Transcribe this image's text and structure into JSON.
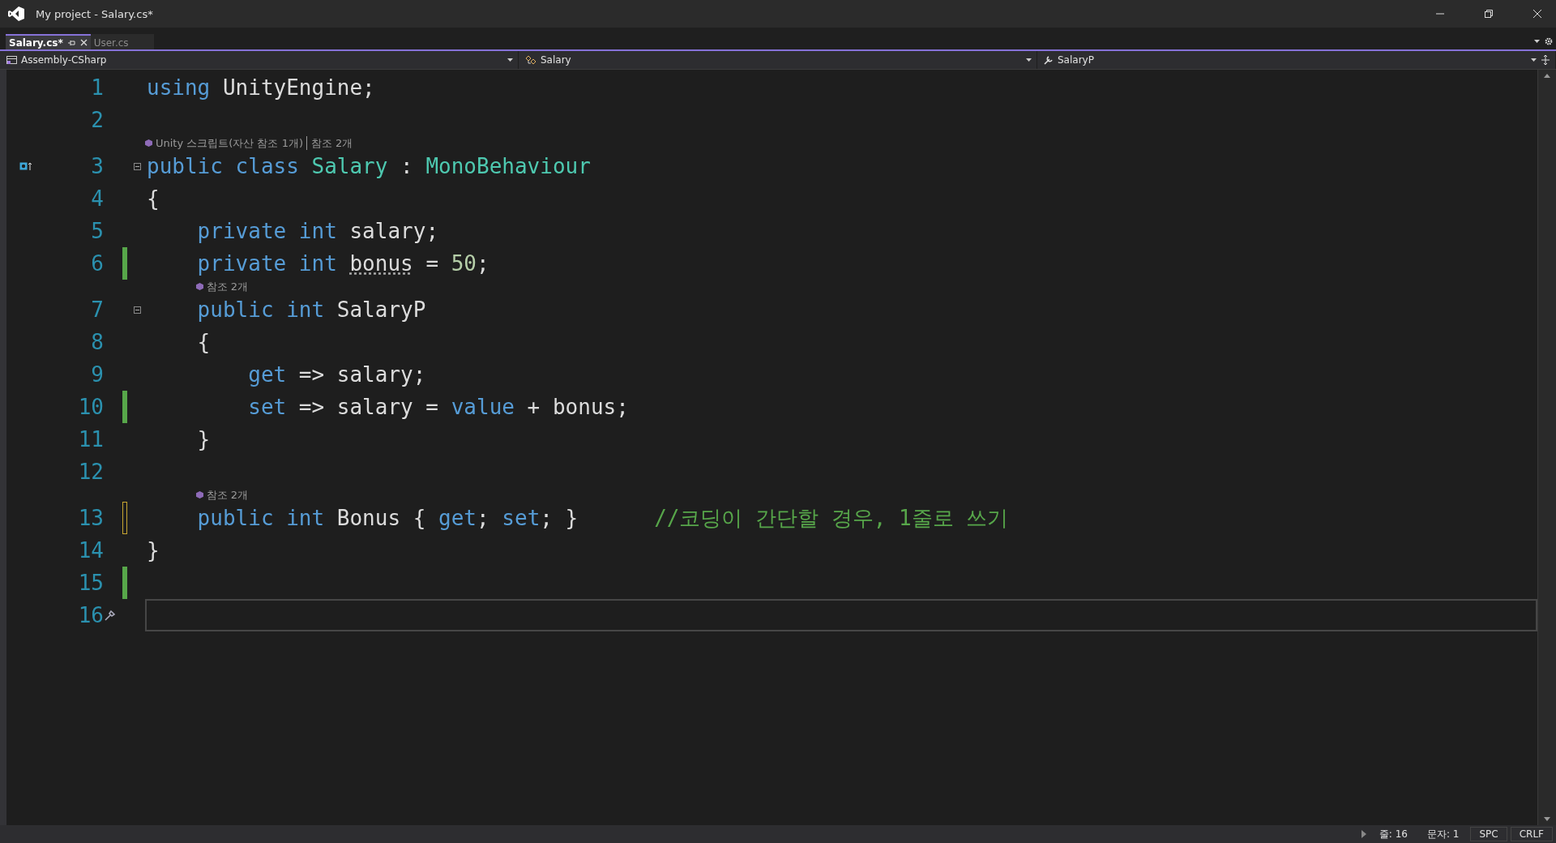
{
  "window": {
    "title": "My project - Salary.cs*"
  },
  "tabs": [
    {
      "label": "Salary.cs*",
      "selected": true
    },
    {
      "label": "User.cs",
      "selected": false
    }
  ],
  "nav": {
    "project": "Assembly-CSharp",
    "type": "Salary",
    "member": "SalaryP"
  },
  "lines": [
    {
      "number": "1",
      "changed": false,
      "tokens": [
        {
          "text": "using",
          "kind": "keyword"
        },
        {
          "text": " UnityEngine;",
          "kind": "plain"
        }
      ]
    },
    {
      "number": "2",
      "changed": false
    },
    {
      "number": "3",
      "changed": false,
      "fold": true,
      "glyph": true,
      "codelens": [
        "Unity 스크립트(자산 참조 1개)",
        "참조 2개"
      ],
      "tokens": [
        {
          "text": "public class ",
          "kind": "keyword"
        },
        {
          "text": "Salary",
          "kind": "type"
        },
        {
          "text": " : ",
          "kind": "plain"
        },
        {
          "text": "MonoBehaviour",
          "kind": "type"
        }
      ]
    },
    {
      "number": "4",
      "changed": false,
      "tokens": [
        {
          "text": "{",
          "kind": "plain"
        }
      ]
    },
    {
      "number": "5",
      "changed": false,
      "tokens": [
        {
          "text": "    private int",
          "kind": "keyword"
        },
        {
          "text": " salary;",
          "kind": "plain"
        }
      ]
    },
    {
      "number": "6",
      "changed": true,
      "saved": true,
      "tokens": [
        {
          "text": "    private int ",
          "kind": "keyword"
        },
        {
          "text": "bonus",
          "kind": "plain",
          "hint": true
        },
        {
          "text": " = ",
          "kind": "plain"
        },
        {
          "text": "50",
          "kind": "number"
        },
        {
          "text": ";",
          "kind": "plain"
        }
      ]
    },
    {
      "number": "7",
      "changed": false,
      "fold": true,
      "codelens": [
        "참조 2개"
      ],
      "tokens": [
        {
          "text": "    public int",
          "kind": "keyword"
        },
        {
          "text": " SalaryP",
          "kind": "plain"
        }
      ]
    },
    {
      "number": "8",
      "changed": false,
      "tokens": [
        {
          "text": "    {",
          "kind": "plain"
        }
      ]
    },
    {
      "number": "9",
      "changed": false,
      "tokens": [
        {
          "text": "        get",
          "kind": "keyword"
        },
        {
          "text": " => salary;",
          "kind": "plain"
        }
      ]
    },
    {
      "number": "10",
      "changed": true,
      "saved": true,
      "tokens": [
        {
          "text": "        set",
          "kind": "keyword"
        },
        {
          "text": " => salary = ",
          "kind": "plain"
        },
        {
          "text": "value",
          "kind": "keyword"
        },
        {
          "text": " + bonus;",
          "kind": "plain"
        }
      ]
    },
    {
      "number": "11",
      "changed": false,
      "tokens": [
        {
          "text": "    }",
          "kind": "plain"
        }
      ]
    },
    {
      "number": "12",
      "changed": false
    },
    {
      "number": "13",
      "changed": true,
      "saved": false,
      "codelens": [
        "참조 2개"
      ],
      "tokens": [
        {
          "text": "    public int",
          "kind": "keyword"
        },
        {
          "text": " Bonus { ",
          "kind": "plain"
        },
        {
          "text": "get",
          "kind": "keyword"
        },
        {
          "text": "; ",
          "kind": "plain"
        },
        {
          "text": "set",
          "kind": "keyword"
        },
        {
          "text": "; }      ",
          "kind": "plain"
        },
        {
          "text": "//코딩이 간단할 경우, 1줄로 쓰기",
          "kind": "comment"
        }
      ]
    },
    {
      "number": "14",
      "changed": false,
      "tokens": [
        {
          "text": "}",
          "kind": "plain"
        }
      ]
    },
    {
      "number": "15",
      "changed": true,
      "saved": true
    },
    {
      "number": "16",
      "changed": false,
      "current": true,
      "quick_action": true
    }
  ],
  "status": {
    "line": "줄: 16",
    "column": "문자: 1",
    "indent": "SPC",
    "eol": "CRLF"
  }
}
